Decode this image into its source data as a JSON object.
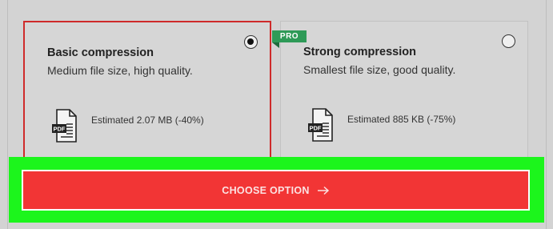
{
  "options": [
    {
      "id": "basic",
      "title": "Basic compression",
      "description": "Medium file size, high quality.",
      "estimate": "Estimated 2.07 MB (-40%)",
      "selected": true,
      "icon": "pdf-file-icon"
    },
    {
      "id": "strong",
      "title": "Strong compression",
      "description": "Smallest file size, good quality.",
      "estimate": "Estimated 885 KB (-75%)",
      "selected": false,
      "badge": "PRO",
      "icon": "pdf-file-icon"
    }
  ],
  "pdf_icon_label": "PDF",
  "action": {
    "label": "CHOOSE OPTION",
    "icon": "arrow-right-icon"
  },
  "colors": {
    "selected_border": "#cf2b2b",
    "pro_badge": "#2e9a57",
    "button": "#f23535",
    "highlight": "#1cf51c"
  }
}
